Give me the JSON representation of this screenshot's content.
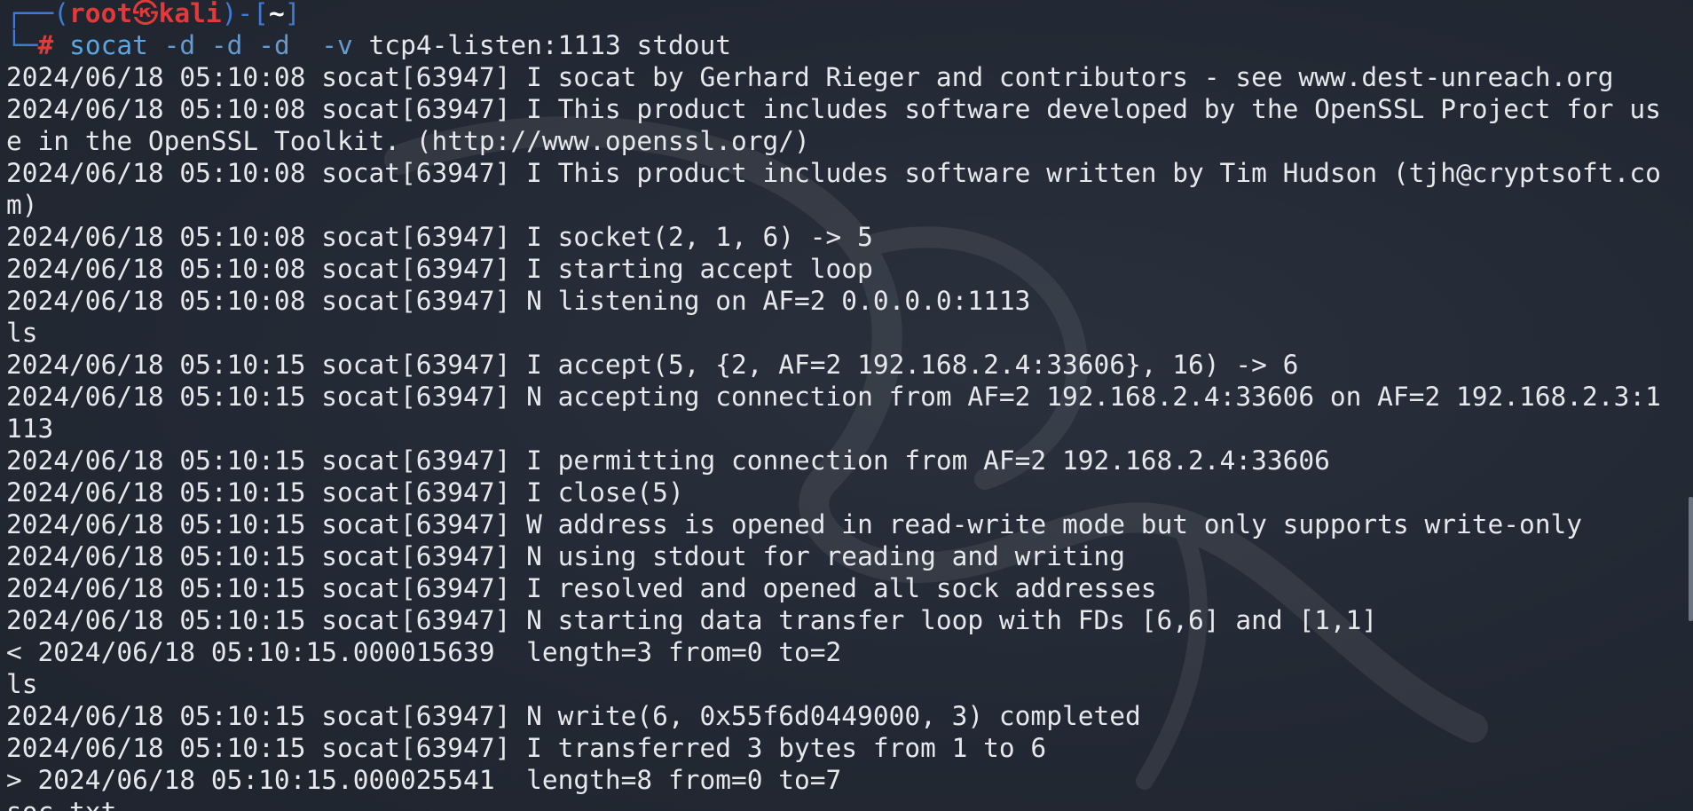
{
  "prompt": {
    "box_top_left": "┌──(",
    "user": "root",
    "skull": "㉿",
    "host": "kali",
    "box_mid": ")-[",
    "cwd": "~",
    "box_end": "]",
    "box_bottom": "└─",
    "hash": "#",
    "command": "socat",
    "options": "-d -d -d  -v",
    "args": "tcp4-listen:1113 stdout"
  },
  "output_lines": [
    "2024/06/18 05:10:08 socat[63947] I socat by Gerhard Rieger and contributors - see www.dest-unreach.org",
    "2024/06/18 05:10:08 socat[63947] I This product includes software developed by the OpenSSL Project for us",
    "e in the OpenSSL Toolkit. (http://www.openssl.org/)",
    "2024/06/18 05:10:08 socat[63947] I This product includes software written by Tim Hudson (tjh@cryptsoft.co",
    "m)",
    "2024/06/18 05:10:08 socat[63947] I socket(2, 1, 6) -> 5",
    "2024/06/18 05:10:08 socat[63947] I starting accept loop",
    "2024/06/18 05:10:08 socat[63947] N listening on AF=2 0.0.0.0:1113",
    "ls",
    "2024/06/18 05:10:15 socat[63947] I accept(5, {2, AF=2 192.168.2.4:33606}, 16) -> 6",
    "2024/06/18 05:10:15 socat[63947] N accepting connection from AF=2 192.168.2.4:33606 on AF=2 192.168.2.3:1",
    "113",
    "2024/06/18 05:10:15 socat[63947] I permitting connection from AF=2 192.168.2.4:33606",
    "2024/06/18 05:10:15 socat[63947] I close(5)",
    "2024/06/18 05:10:15 socat[63947] W address is opened in read-write mode but only supports write-only",
    "2024/06/18 05:10:15 socat[63947] N using stdout for reading and writing",
    "2024/06/18 05:10:15 socat[63947] I resolved and opened all sock addresses",
    "2024/06/18 05:10:15 socat[63947] N starting data transfer loop with FDs [6,6] and [1,1]",
    "< 2024/06/18 05:10:15.000015639  length=3 from=0 to=2",
    "ls",
    "2024/06/18 05:10:15 socat[63947] N write(6, 0x55f6d0449000, 3) completed",
    "2024/06/18 05:10:15 socat[63947] I transferred 3 bytes from 1 to 6",
    "> 2024/06/18 05:10:15.000025541  length=8 from=0 to=7",
    "soc.txt"
  ],
  "colors": {
    "background": "#232934",
    "text": "#e6e8ec",
    "prompt_box": "#3f7bd6",
    "prompt_user": "#e53939",
    "command": "#5ea6e0"
  },
  "icons": {
    "watermark": "kali-dragon-icon",
    "scrollbar": "scrollbar-thumb"
  }
}
